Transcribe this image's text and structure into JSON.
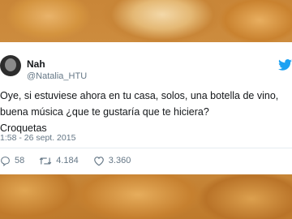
{
  "tweet": {
    "name": "Nah",
    "handle": "@Natalia_HTU",
    "lines": [
      "Oye, si estuviese ahora en tu casa, solos, una botella de vino,",
      "buena música ¿que te gustaría que te hiciera?",
      "Croquetas"
    ],
    "timestamp": "1:58 - 26 sept. 2015",
    "replies": "58",
    "retweets": "4.184",
    "likes": "3.360"
  },
  "icons": {
    "brand": "twitter-bird-icon",
    "reply": "reply-icon",
    "retweet": "retweet-icon",
    "like": "heart-icon"
  },
  "colors": {
    "twitter_blue": "#1da1f2",
    "text": "#14171a",
    "muted": "#657786"
  }
}
